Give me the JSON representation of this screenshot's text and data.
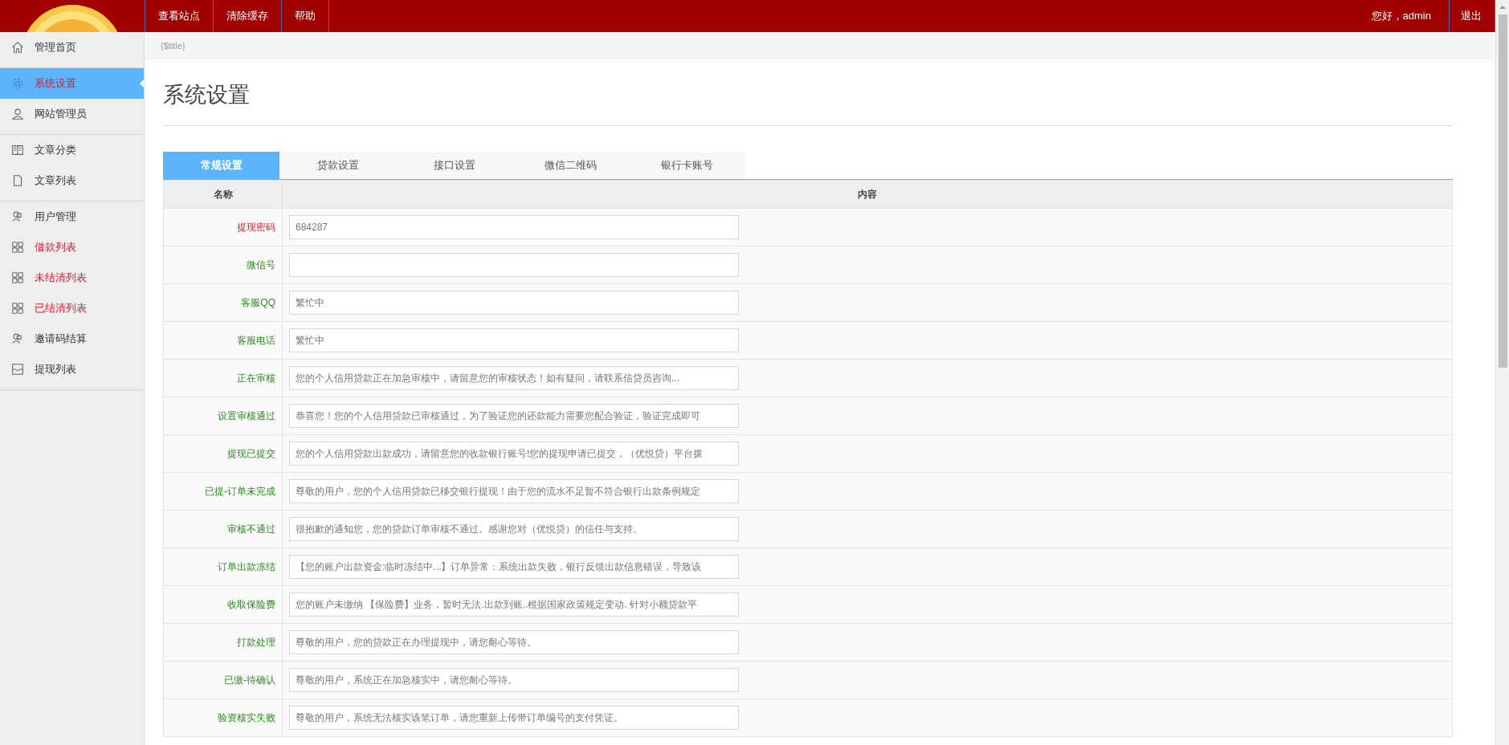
{
  "topbar": {
    "nav": [
      {
        "label": "查看站点"
      },
      {
        "label": "清除缓存"
      },
      {
        "label": "帮助"
      }
    ],
    "greeting": "您好，admin",
    "logout": "退出"
  },
  "sidebar": {
    "groups": [
      {
        "items": [
          {
            "label": "管理首页",
            "selected": false,
            "highlighted": false
          }
        ]
      },
      {
        "items": [
          {
            "label": "系统设置",
            "selected": true,
            "highlighted": true
          },
          {
            "label": "网站管理员",
            "selected": false,
            "highlighted": false
          }
        ]
      },
      {
        "items": [
          {
            "label": "文章分类",
            "selected": false,
            "highlighted": false
          },
          {
            "label": "文章列表",
            "selected": false,
            "highlighted": false
          }
        ]
      },
      {
        "items": [
          {
            "label": "用户管理",
            "selected": false,
            "highlighted": false
          },
          {
            "label": "借款列表",
            "selected": false,
            "highlighted": true
          },
          {
            "label": "未结清列表",
            "selected": false,
            "highlighted": true
          },
          {
            "label": "已结清列表",
            "selected": false,
            "highlighted": true
          },
          {
            "label": "邀请码结算",
            "selected": false,
            "highlighted": false
          },
          {
            "label": "提现列表",
            "selected": false,
            "highlighted": false
          }
        ]
      }
    ]
  },
  "breadcrumb": "{$title}",
  "page_title": "系统设置",
  "tabs": [
    {
      "label": "常规设置",
      "selected": true
    },
    {
      "label": "贷款设置",
      "selected": false
    },
    {
      "label": "接口设置",
      "selected": false
    },
    {
      "label": "微信二维码",
      "selected": false
    },
    {
      "label": "银行卡账号",
      "selected": false
    }
  ],
  "table": {
    "columns": [
      "名称",
      "内容"
    ],
    "rows": [
      {
        "label": "提现密码",
        "highlighted": true,
        "value": "684287"
      },
      {
        "label": "微信号",
        "highlighted": false
      },
      {
        "label": "客服QQ",
        "highlighted": false,
        "value": "繁忙中"
      },
      {
        "label": "客服电话",
        "highlighted": false,
        "value": "繁忙中"
      },
      {
        "label": "正在审核",
        "highlighted": false,
        "value": "您的个人信用贷款正在加急审核中，请留意您的审核状态！如有疑问，请联系信贷员咨询..."
      },
      {
        "label": "设置审核通过",
        "highlighted": false,
        "value": "恭喜您！您的个人信用贷款已审核通过，为了验证您的还款能力需要您配合验证，验证完成即可"
      },
      {
        "label": "提现已提交",
        "highlighted": false,
        "value": "您的个人信用贷款出款成功，请留意您的收款银行账号!您的提现申请已提交，（优悦贷）平台拨"
      },
      {
        "label": "已提-订单未完成",
        "highlighted": false,
        "value": "尊敬的用户，您的个人信用贷款已移交银行提现！由于您的流水不足暂不符合银行出款条例规定"
      },
      {
        "label": "审核不通过",
        "highlighted": false,
        "value": "很抱歉的通知您，您的贷款订单审核不通过。感谢您对（优悦贷）的信任与支持。"
      },
      {
        "label": "订单出款冻结",
        "highlighted": false,
        "value": "【您的账户出款资金:临时冻结中...】订单异常：系统出款失败，银行反馈出款信息错误，导致该"
      },
      {
        "label": "收取保险费",
        "highlighted": false,
        "value": "您的账户未缴纳 【保险费】业务，暂时无法.出款到账..根据国家政策规定变动. 针对小额贷款平"
      },
      {
        "label": "打款处理",
        "highlighted": false,
        "value": "尊敬的用户，您的贷款正在办理提现中，请您耐心等待。"
      },
      {
        "label": "已缴-待确认",
        "highlighted": false,
        "value": "尊敬的用户，系统正在加急核实中，请您耐心等待。"
      },
      {
        "label": "验资核实失败",
        "highlighted": false,
        "value": "尊敬的用户，系统无法核实该笔订单，请您重新上传带订单编号的支付凭证。"
      }
    ]
  }
}
